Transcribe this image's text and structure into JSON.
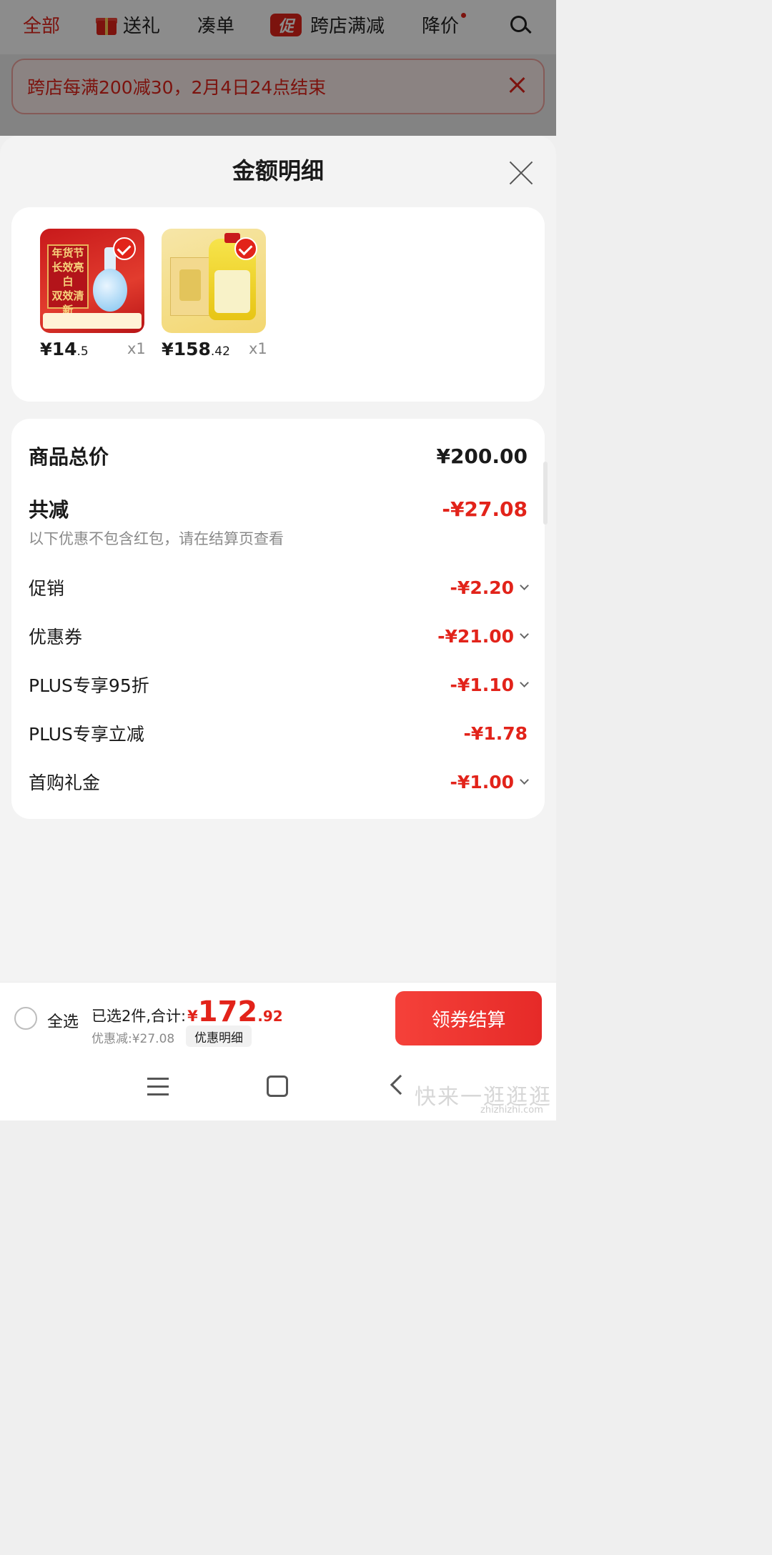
{
  "top_nav": {
    "tabs": [
      {
        "label": "全部"
      },
      {
        "label": "送礼"
      },
      {
        "label": "凑单"
      },
      {
        "label": "跨店满减",
        "badge_icon_text": "促"
      },
      {
        "label": "降价"
      }
    ]
  },
  "promo_banner": {
    "text": "跨店每满200减30，2月4日24点结束"
  },
  "sheet": {
    "title": "金额明细",
    "products": [
      {
        "price_currency": "¥",
        "price_int": "14",
        "price_dec": ".5",
        "qty": "x1",
        "image_text": [
          "年货节",
          "长效亮白",
          "双效清新"
        ]
      },
      {
        "price_currency": "¥",
        "price_int": "158",
        "price_dec": ".42",
        "qty": "x1"
      }
    ],
    "summary": {
      "total_label": "商品总价",
      "total_value": "¥200.00",
      "reduce_label": "共减",
      "reduce_value": "-¥27.08",
      "note": "以下优惠不包含红包，请在结算页查看",
      "items": [
        {
          "label": "促销",
          "value": "-¥2.20",
          "expandable": true
        },
        {
          "label": "优惠券",
          "value": "-¥21.00",
          "expandable": true
        },
        {
          "label": "PLUS专享95折",
          "value": "-¥1.10",
          "expandable": true
        },
        {
          "label": "PLUS专享立减",
          "value": "-¥1.78",
          "expandable": false
        },
        {
          "label": "首购礼金",
          "value": "-¥1.00",
          "expandable": true
        }
      ]
    }
  },
  "bottom_bar": {
    "select_all": "全选",
    "selected_text": "已选2件,合计:",
    "total_currency": "¥",
    "total_int": "172",
    "total_dec": ".92",
    "discount_text": "优惠减:¥27.08",
    "detail_button": "优惠明细",
    "checkout_button": "领券结算"
  },
  "watermark": {
    "text": "快来一逛逛逛",
    "sub": "zhizhizhi.com"
  },
  "colors": {
    "accent": "#e2231a",
    "checkout": "#f5413a"
  }
}
